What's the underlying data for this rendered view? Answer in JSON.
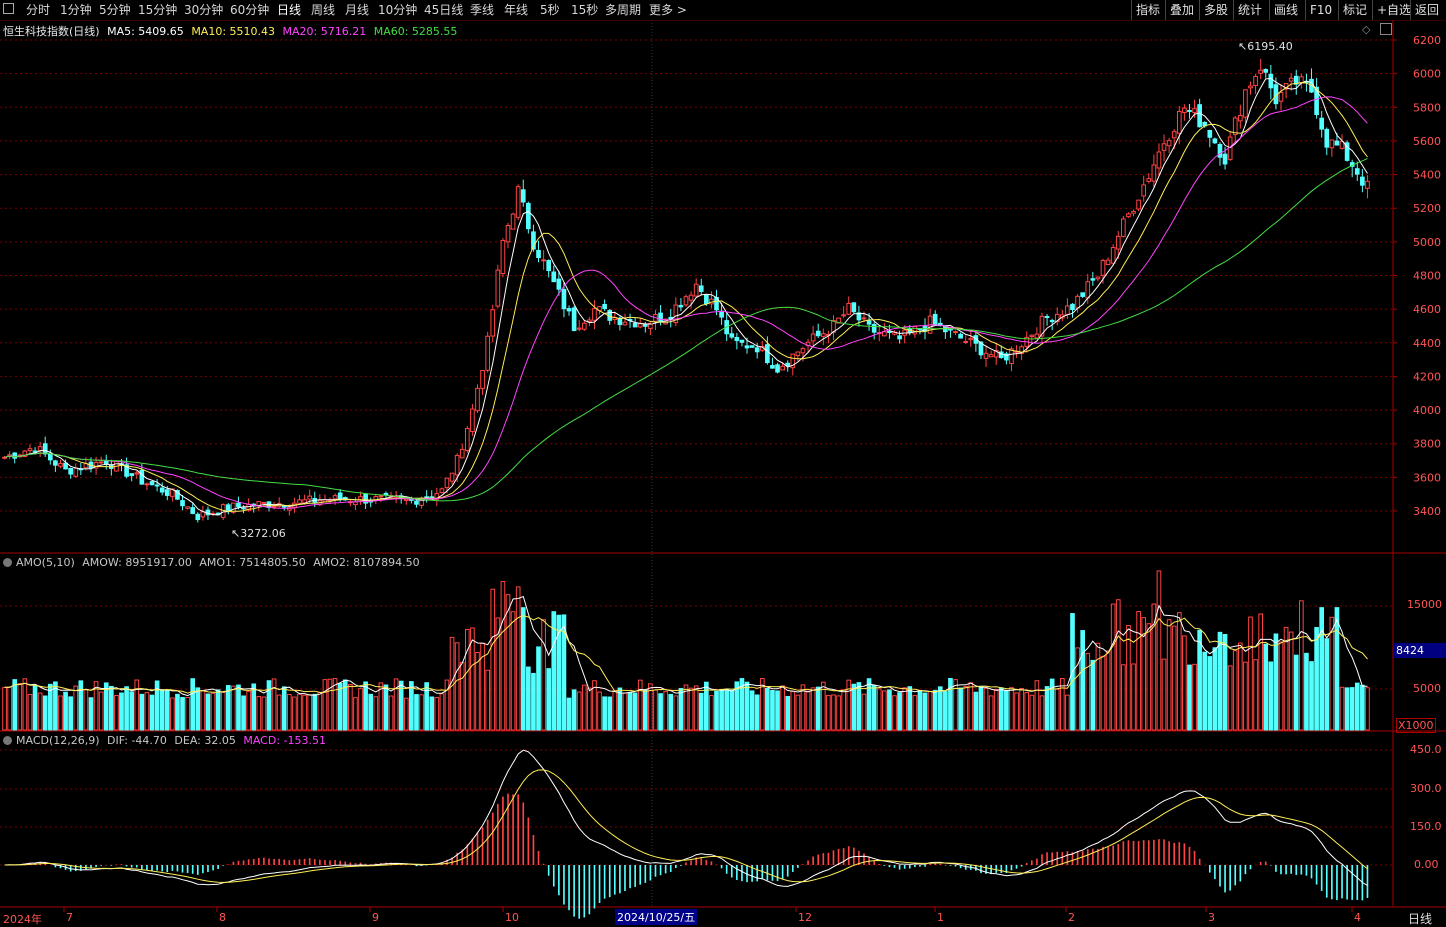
{
  "toolbar": {
    "periods": [
      "分时",
      "1分钟",
      "5分钟",
      "15分钟",
      "30分钟",
      "60分钟",
      "日线",
      "周线",
      "月线",
      "10分钟",
      "45日线",
      "季线",
      "年线",
      "5秒",
      "15秒",
      "多周期",
      "更多 >"
    ],
    "active": "日线",
    "right_buttons": [
      "指标",
      "叠加",
      "多股",
      "统计",
      "画线",
      "F10",
      "标记",
      "+自选",
      "返回"
    ]
  },
  "main_panel": {
    "title": "恒生科技指数(日线)",
    "ma": [
      {
        "label": "MA5: 5409.65",
        "color": "#ffffff"
      },
      {
        "label": "MA10: 5510.43",
        "color": "#ffee55"
      },
      {
        "label": "MA20: 5716.21",
        "color": "#ff44ff"
      },
      {
        "label": "MA60: 5285.55",
        "color": "#44dd44"
      }
    ],
    "y_ticks": [
      "6200",
      "6000",
      "5800",
      "5600",
      "5400",
      "5200",
      "5000",
      "4800",
      "4600",
      "4400",
      "4200",
      "4000",
      "3800",
      "3600",
      "3400"
    ],
    "high_label": "6195.40",
    "low_label": "3272.06"
  },
  "amo_panel": {
    "title": "AMO(5,10)",
    "values": [
      {
        "label": "AMOW: 8951917.00",
        "color": "#e0e0e0"
      },
      {
        "label": "AMO1: 7514805.50",
        "color": "#e0e0e0"
      },
      {
        "label": "AMO2: 8107894.50",
        "color": "#e0e0e0"
      }
    ],
    "y_ticks": [
      "15000",
      "5000"
    ],
    "current_value": "8424",
    "unit": "X1000"
  },
  "macd_panel": {
    "title": "MACD(12,26,9)",
    "values": [
      {
        "label": "DIF: -44.70",
        "color": "#e0e0e0"
      },
      {
        "label": "DEA: 32.05",
        "color": "#e0e0e0"
      },
      {
        "label": "MACD: -153.51",
        "color": "#ff44ff"
      }
    ],
    "y_ticks": [
      "450.0",
      "300.0",
      "150.0",
      "0.00"
    ]
  },
  "x_axis": {
    "labels": [
      "2024年",
      "7",
      "8",
      "9",
      "10",
      "12",
      "1",
      "2",
      "3",
      "4"
    ],
    "cursor_label": "2024/10/25/五",
    "period_label": "日线"
  },
  "colors": {
    "up": "#ff4444",
    "down": "#54ffff",
    "grid": "#7a0000",
    "border": "#aa0000"
  },
  "chart_data": {
    "type": "candlestick",
    "title": "恒生科技指数(日线)",
    "ylim": [
      3200,
      6250
    ],
    "anchors": [
      [
        0,
        3720
      ],
      [
        6,
        3780
      ],
      [
        12,
        3640
      ],
      [
        20,
        3700
      ],
      [
        27,
        3580
      ],
      [
        33,
        3500
      ],
      [
        38,
        3370
      ],
      [
        44,
        3420
      ],
      [
        50,
        3440
      ],
      [
        56,
        3450
      ],
      [
        64,
        3470
      ],
      [
        72,
        3470
      ],
      [
        80,
        3460
      ],
      [
        86,
        3520
      ],
      [
        89,
        3700
      ],
      [
        92,
        4000
      ],
      [
        95,
        4400
      ],
      [
        98,
        5000
      ],
      [
        101,
        5300
      ],
      [
        104,
        5000
      ],
      [
        108,
        4750
      ],
      [
        112,
        4500
      ],
      [
        116,
        4600
      ],
      [
        120,
        4550
      ],
      [
        126,
        4520
      ],
      [
        131,
        4580
      ],
      [
        136,
        4750
      ],
      [
        140,
        4600
      ],
      [
        143,
        4400
      ],
      [
        148,
        4380
      ],
      [
        152,
        4250
      ],
      [
        158,
        4400
      ],
      [
        163,
        4500
      ],
      [
        166,
        4600
      ],
      [
        170,
        4480
      ],
      [
        176,
        4420
      ],
      [
        182,
        4520
      ],
      [
        186,
        4460
      ],
      [
        191,
        4380
      ],
      [
        196,
        4300
      ],
      [
        200,
        4400
      ],
      [
        205,
        4550
      ],
      [
        210,
        4620
      ],
      [
        215,
        4800
      ],
      [
        220,
        5100
      ],
      [
        225,
        5400
      ],
      [
        228,
        5600
      ],
      [
        232,
        5800
      ],
      [
        236,
        5700
      ],
      [
        240,
        5500
      ],
      [
        244,
        5900
      ],
      [
        247,
        6050
      ],
      [
        250,
        5850
      ],
      [
        254,
        5950
      ],
      [
        257,
        5900
      ],
      [
        260,
        5600
      ],
      [
        263,
        5550
      ],
      [
        266,
        5420
      ],
      [
        268,
        5320
      ]
    ]
  }
}
